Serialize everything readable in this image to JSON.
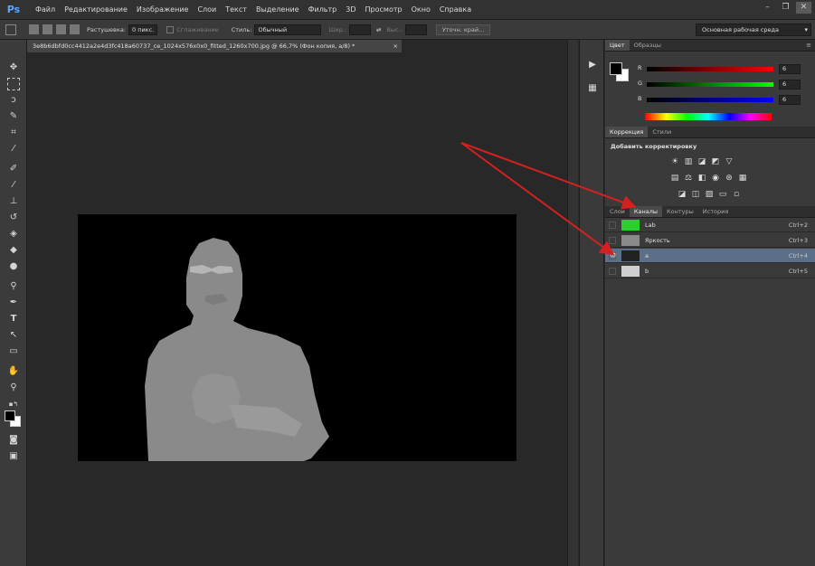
{
  "app": {
    "logo": "Ps"
  },
  "menu": [
    "Файл",
    "Редактирование",
    "Изображение",
    "Слои",
    "Текст",
    "Выделение",
    "Фильтр",
    "3D",
    "Просмотр",
    "Окно",
    "Справка"
  ],
  "window_controls": {
    "minimize": "–",
    "restore": "❐",
    "close": "✕"
  },
  "options": {
    "feather_label": "Растушевка:",
    "feather_value": "0 пикс.",
    "antialias_label": "Сглаживание",
    "style_label": "Стиль:",
    "style_value": "Обычный",
    "width_label": "Шир.:",
    "height_label": "Выс.:",
    "refine_button": "Уточн. край...",
    "workspace": "Основная рабочая среда"
  },
  "document": {
    "tab_title": "3e8b6dbfd0cc4412a2e4d3fc418a60737_ce_1024x576x0x0_fitted_1260x700.jpg @ 66,7% (Фон копия, a/8) *",
    "tab_close": "×"
  },
  "color_panel": {
    "tabs": [
      "Цвет",
      "Образцы"
    ],
    "menu": "≡",
    "channels": [
      {
        "label": "R",
        "value": "6"
      },
      {
        "label": "G",
        "value": "6"
      },
      {
        "label": "B",
        "value": "6"
      }
    ]
  },
  "adjustments_panel": {
    "tabs": [
      "Коррекция",
      "Стили"
    ],
    "title": "Добавить корректировку"
  },
  "channels_panel": {
    "tabs": [
      "Слои",
      "Каналы",
      "Контуры",
      "История"
    ],
    "active_tab": "Каналы",
    "rows": [
      {
        "name": "Lab",
        "shortcut": "Ctrl+2",
        "visible": "",
        "thumb_color": "#2ad12a"
      },
      {
        "name": "Яркость",
        "shortcut": "Ctrl+3",
        "visible": "",
        "thumb_color": "#8a8a8a"
      },
      {
        "name": "a",
        "shortcut": "Ctrl+4",
        "visible": "👁",
        "thumb_color": "#222222"
      },
      {
        "name": "b",
        "shortcut": "Ctrl+5",
        "visible": "",
        "thumb_color": "#cfcfcf"
      }
    ]
  },
  "colors": {
    "accent_red": "#d42020",
    "selected_row": "#5b6f89"
  }
}
